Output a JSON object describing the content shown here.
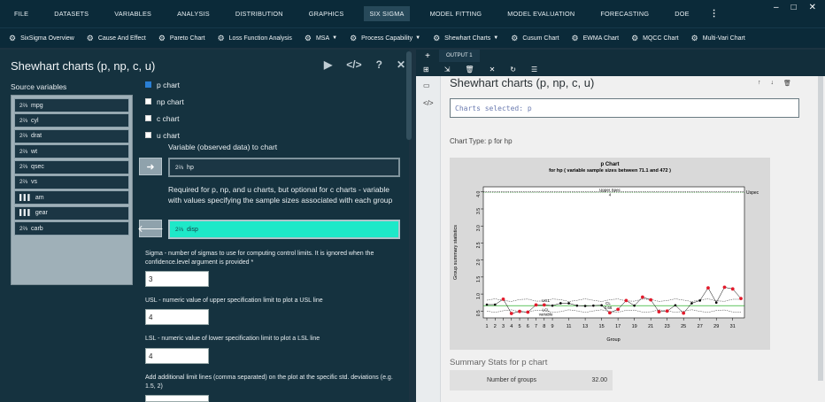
{
  "menubar": {
    "items": [
      "FILE",
      "DATASETS",
      "VARIABLES",
      "ANALYSIS",
      "DISTRIBUTION",
      "GRAPHICS",
      "SIX SIGMA",
      "MODEL FITTING",
      "MODEL EVALUATION",
      "FORECASTING",
      "DOE"
    ],
    "active": "SIX SIGMA",
    "more_icon": "vertical-dots-icon",
    "window_controls": [
      "–",
      "□",
      "✕"
    ]
  },
  "toolbar": {
    "items": [
      {
        "label": "SixSigma Overview",
        "icon": "gear-icon",
        "has_caret": false
      },
      {
        "label": "Cause And Effect",
        "icon": "gear-icon",
        "has_caret": false
      },
      {
        "label": "Pareto Chart",
        "icon": "gear-icon",
        "has_caret": false
      },
      {
        "label": "Loss Function Analysis",
        "icon": "gear-icon",
        "has_caret": false
      },
      {
        "label": "MSA",
        "icon": "gear-icon",
        "has_caret": true
      },
      {
        "label": "Process Capability",
        "icon": "gear-icon",
        "has_caret": true
      },
      {
        "label": "Shewhart Charts",
        "icon": "gear-icon",
        "has_caret": true
      },
      {
        "label": "Cusum Chart",
        "icon": "gear-icon",
        "has_caret": false
      },
      {
        "label": "EWMA Chart",
        "icon": "gear-icon",
        "has_caret": false
      },
      {
        "label": "MQCC Chart",
        "icon": "gear-icon",
        "has_caret": false
      },
      {
        "label": "Multi-Vari Chart",
        "icon": "gear-icon",
        "has_caret": false
      }
    ]
  },
  "dialog": {
    "title": "Shewhart charts (p, np, c, u)",
    "source_label": "Source variables",
    "variables": [
      {
        "name": "mpg",
        "type": "scale"
      },
      {
        "name": "cyl",
        "type": "scale"
      },
      {
        "name": "drat",
        "type": "scale"
      },
      {
        "name": "wt",
        "type": "scale"
      },
      {
        "name": "qsec",
        "type": "scale"
      },
      {
        "name": "vs",
        "type": "scale"
      },
      {
        "name": "am",
        "type": "factor"
      },
      {
        "name": "gear",
        "type": "factor"
      },
      {
        "name": "carb",
        "type": "scale"
      }
    ],
    "charts": [
      {
        "label": "p chart",
        "checked": true
      },
      {
        "label": "np chart",
        "checked": false
      },
      {
        "label": "c chart",
        "checked": false
      },
      {
        "label": "u chart",
        "checked": false
      }
    ],
    "variable_label": "Variable (observed data) to chart",
    "variable_value": "hp",
    "sizes_label": "Required for p, np, and u charts, but optional for c charts - variable with values specifying the sample sizes associated with each group",
    "sizes_value": "disp",
    "sigma_label": "Sigma - number of sigmas to use for computing control limits. It is ignored when the confidence.level argument is provided *",
    "sigma_value": "3",
    "usl_label": "USL - numeric value of upper specification limit to plot a USL line",
    "usl_value": "4",
    "lsl_label": "LSL - numeric value of lower specification limit to plot a LSL line",
    "lsl_value": "4",
    "addl_label": "Add additional limit lines (comma separated) on the plot at the specific std. deviations (e.g. 1.5, 2)"
  },
  "output": {
    "tab_label": "OUTPUT 1",
    "title": "Shewhart charts (p, np, c, u)",
    "selected_text": "Charts selected: p",
    "chart_type_text": "Chart Type: p for hp",
    "summary_header": "Summary Stats for p chart",
    "summary": [
      {
        "key": "Number of groups",
        "value": "32.00"
      }
    ]
  },
  "chart_data": {
    "type": "line",
    "title": "p Chart",
    "subtitle": "for hp ( variable sample sizes between 71.1 and 472 )",
    "xlabel": "Group",
    "ylabel": "Group summary statistics",
    "xlim": [
      1,
      32
    ],
    "ylim": [
      0.3,
      4.15
    ],
    "xticks": [
      1,
      2,
      3,
      4,
      5,
      6,
      7,
      8,
      9,
      11,
      13,
      15,
      17,
      19,
      21,
      23,
      25,
      27,
      29,
      31
    ],
    "yticks": [
      0.5,
      1.0,
      1.5,
      2.0,
      2.5,
      3.0,
      3.5,
      4.0
    ],
    "x": [
      1,
      2,
      3,
      4,
      5,
      6,
      7,
      8,
      9,
      10,
      11,
      12,
      13,
      14,
      15,
      16,
      17,
      18,
      19,
      20,
      21,
      22,
      23,
      24,
      25,
      26,
      27,
      28,
      29,
      30,
      31,
      32
    ],
    "values": [
      0.69,
      0.69,
      0.85,
      0.43,
      0.49,
      0.47,
      0.68,
      0.68,
      0.66,
      0.73,
      0.73,
      0.66,
      0.65,
      0.66,
      0.67,
      0.45,
      0.55,
      0.81,
      0.66,
      0.91,
      0.83,
      0.48,
      0.5,
      0.67,
      0.44,
      0.73,
      0.81,
      1.18,
      0.75,
      1.2,
      1.15,
      0.87
    ],
    "out_of_control": [
      3,
      4,
      5,
      6,
      7,
      8,
      16,
      17,
      18,
      20,
      21,
      22,
      23,
      25,
      28,
      30,
      31,
      32
    ],
    "center_line": 0.66,
    "ucl_label": "UCL",
    "cl_label": "CL",
    "cl_value_label": "0.66",
    "lcl_label": "LCL",
    "lcl_sub_label": "variable",
    "ucl_level": 0.82,
    "lcl_level": 0.52,
    "usl": 4.0,
    "lsl": 4.0,
    "usl_label": "Upper Spec",
    "usl_value_label": "4",
    "uspec_label": "Uspec",
    "colors": {
      "points": "#000000",
      "violations": "#e21b2c",
      "limits": "#000000",
      "center": "#00a000",
      "spec": "#000000",
      "bg": "#d9d9d9"
    }
  }
}
